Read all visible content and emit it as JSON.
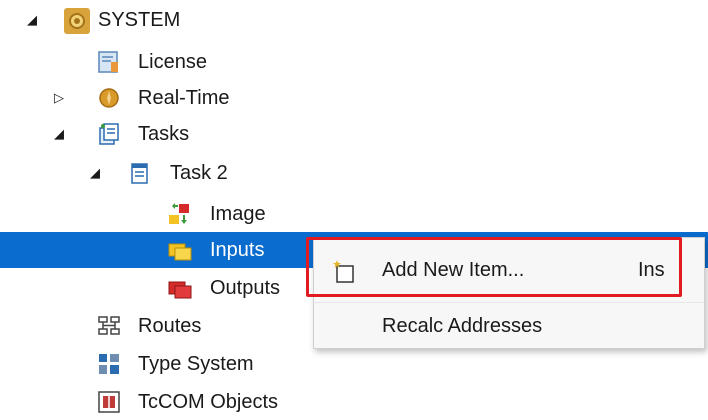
{
  "tree": {
    "system": {
      "label": "SYSTEM",
      "icon": "system-gear-icon"
    },
    "license": {
      "label": "License",
      "icon": "license-certificate-icon"
    },
    "realtime": {
      "label": "Real-Time",
      "icon": "realtime-clock-icon"
    },
    "tasks": {
      "label": "Tasks",
      "icon": "tasks-icon"
    },
    "task2": {
      "label": "Task 2",
      "icon": "task-icon"
    },
    "image": {
      "label": "Image",
      "icon": "image-process-icon"
    },
    "inputs": {
      "label": "Inputs",
      "icon": "inputs-folder-icon",
      "selected": true
    },
    "outputs": {
      "label": "Outputs",
      "icon": "outputs-folder-icon"
    },
    "routes": {
      "label": "Routes",
      "icon": "routes-icon"
    },
    "type_system": {
      "label": "Type System",
      "icon": "type-system-icon"
    },
    "tccom": {
      "label": "TcCOM Objects",
      "icon": "tccom-objects-icon"
    }
  },
  "context_menu": {
    "add_new_item": {
      "label": "Add New Item...",
      "shortcut": "Ins",
      "icon": "add-new-item-icon"
    },
    "recalc": {
      "label": "Recalc Addresses"
    }
  },
  "colors": {
    "selection": "#0a6cce",
    "highlight_border": "#e21b23"
  }
}
